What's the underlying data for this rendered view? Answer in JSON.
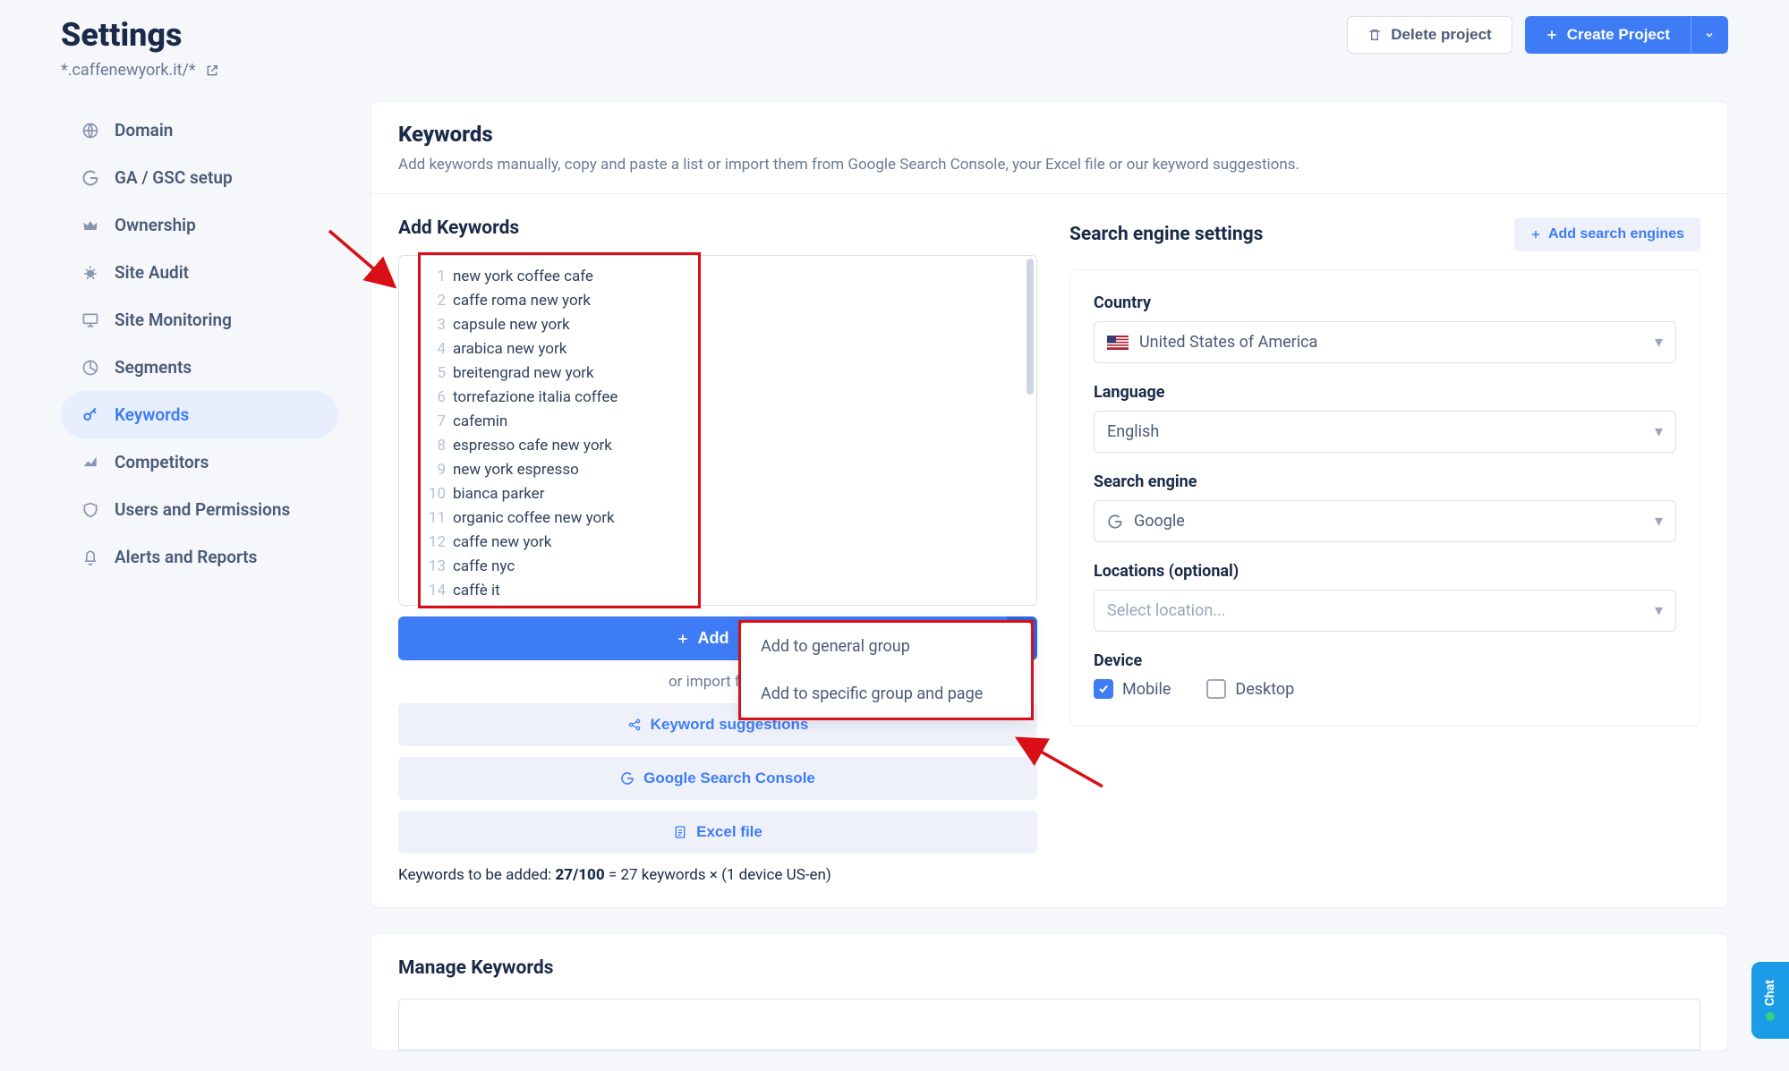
{
  "header": {
    "title": "Settings",
    "domain": "*.caffenewyork.it/*",
    "delete_label": "Delete project",
    "create_label": "Create Project"
  },
  "sidebar": {
    "items": [
      {
        "label": "Domain"
      },
      {
        "label": "GA / GSC setup"
      },
      {
        "label": "Ownership"
      },
      {
        "label": "Site Audit"
      },
      {
        "label": "Site Monitoring"
      },
      {
        "label": "Segments"
      },
      {
        "label": "Keywords"
      },
      {
        "label": "Competitors"
      },
      {
        "label": "Users and Permissions"
      },
      {
        "label": "Alerts and Reports"
      }
    ]
  },
  "card": {
    "title": "Keywords",
    "subtitle": "Add keywords manually, copy and paste a list or import them from Google Search Console, your Excel file or our keyword suggestions."
  },
  "addKeywords": {
    "title": "Add Keywords",
    "lines": [
      "new york coffee cafe",
      "caffe roma new york",
      "capsule new york",
      "arabica new york",
      "breitengrad new york",
      "torrefazione italia coffee",
      "cafemin",
      "espresso cafe new york",
      "new york espresso",
      "bianca parker",
      "organic coffee new york",
      "caffe new york",
      "caffe nyc",
      "caffè it"
    ],
    "add_button": "Add",
    "or_import": "or import from",
    "import_suggestions": "Keyword suggestions",
    "import_gsc": "Google Search Console",
    "import_excel": "Excel file",
    "count_prefix": "Keywords to be added: ",
    "count_value": "27/100",
    "count_suffix": " = 27 keywords × (1 device US-en)"
  },
  "addDropdown": {
    "general": "Add to general group",
    "specific": "Add to specific group and page"
  },
  "engine": {
    "title": "Search engine settings",
    "add_button": "Add search engines",
    "country_label": "Country",
    "country_value": "United States of America",
    "language_label": "Language",
    "language_value": "English",
    "engine_label": "Search engine",
    "engine_value": "Google",
    "locations_label": "Locations (optional)",
    "locations_placeholder": "Select location...",
    "device_label": "Device",
    "device_mobile": "Mobile",
    "device_desktop": "Desktop"
  },
  "manage": {
    "title": "Manage Keywords"
  },
  "chat": {
    "label": "Chat"
  }
}
